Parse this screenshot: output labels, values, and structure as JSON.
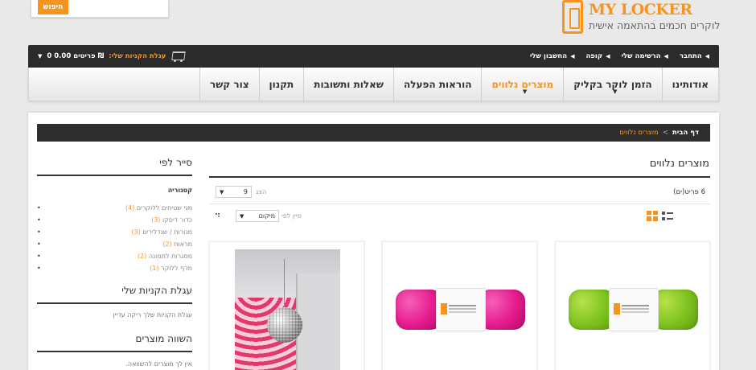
{
  "search": {
    "button_label": "חיפוש"
  },
  "logo": {
    "name": "MY LOCKER",
    "tagline": "לוקרים חכמים בהתאמה אישית"
  },
  "topbar": {
    "links": [
      {
        "label": "החשבון שלי"
      },
      {
        "label": "קופה"
      },
      {
        "label": "הרשימה שלי"
      },
      {
        "label": "התחבר"
      }
    ],
    "cart": {
      "label": "עגלת הקניות שלי:",
      "count_text": "0 פריטים 0.00 ₪"
    }
  },
  "nav": {
    "items": [
      {
        "label": "אודותינו"
      },
      {
        "label": "הזמן לוקר בקליק"
      },
      {
        "label": "מוצרים נלווים"
      },
      {
        "label": "הוראות הפעלה"
      },
      {
        "label": "שאלות ותשובות"
      },
      {
        "label": "תקנון"
      },
      {
        "label": "צור קשר"
      }
    ],
    "active": "מוצרים נלווים"
  },
  "breadcrumb": {
    "home": "דף הבית",
    "separator": ">",
    "current": "מוצרים נלווים"
  },
  "page_title": "מוצרים נלווים",
  "toolbar": {
    "count_text": "6 פריט(ים)",
    "show_label": "הצג",
    "show_value": "9",
    "sort_label": "מיין לפי",
    "sort_value": "מיקום"
  },
  "sidebar": {
    "filter_title": "סייר לפי",
    "category_heading": "קטגוריה",
    "categories": [
      {
        "name": "מגי שטיחים ללוקרים",
        "count": "(4)"
      },
      {
        "name": "כדור דיסקו",
        "count": "(3)"
      },
      {
        "name": "מנורות / שנדלירים",
        "count": "(3)"
      },
      {
        "name": "מראות",
        "count": "(2)"
      },
      {
        "name": "מסגרות לתמונה",
        "count": "(2)"
      },
      {
        "name": "מדף ללוקר",
        "count": "(1)"
      }
    ],
    "cart_title": "עגלת הקניות שלי",
    "cart_empty": "עגלת הקניות שלך ריקה עדיין",
    "compare_title": "השווה מוצרים",
    "compare_empty": "אין לך מוצרים להשוואה."
  },
  "colors": {
    "accent": "#f7941d",
    "dark": "#2b2b2b"
  }
}
